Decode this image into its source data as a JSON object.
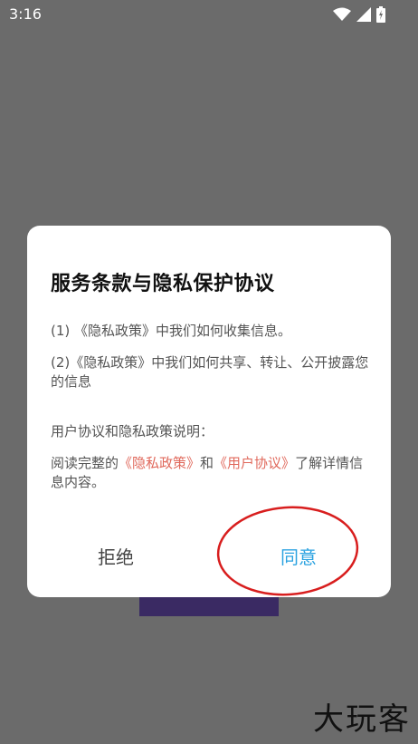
{
  "status_bar": {
    "time": "3:16",
    "icons": [
      "wifi-icon",
      "signal-icon",
      "battery-icon"
    ]
  },
  "dialog": {
    "title": "服务条款与隐私保护协议",
    "item1": "(1) 《隐私政策》中我们如何收集信息。",
    "item2": "(2)《隐私政策》中我们如何共享、转让、公开披露您的信息",
    "section_label": "用户协议和隐私政策说明：",
    "read_prefix": "阅读完整的",
    "privacy_link": "《隐私政策》",
    "and_text": "和",
    "user_agreement_link": "《用户协议》",
    "read_suffix": "了解详情信息内容。",
    "reject_label": "拒绝",
    "agree_label": "同意"
  },
  "watermark": "大玩客",
  "colors": {
    "overlay": "#6b6b6b",
    "link": "#e0685b",
    "agree": "#2aa2e0",
    "annotation": "#d81e1e"
  }
}
